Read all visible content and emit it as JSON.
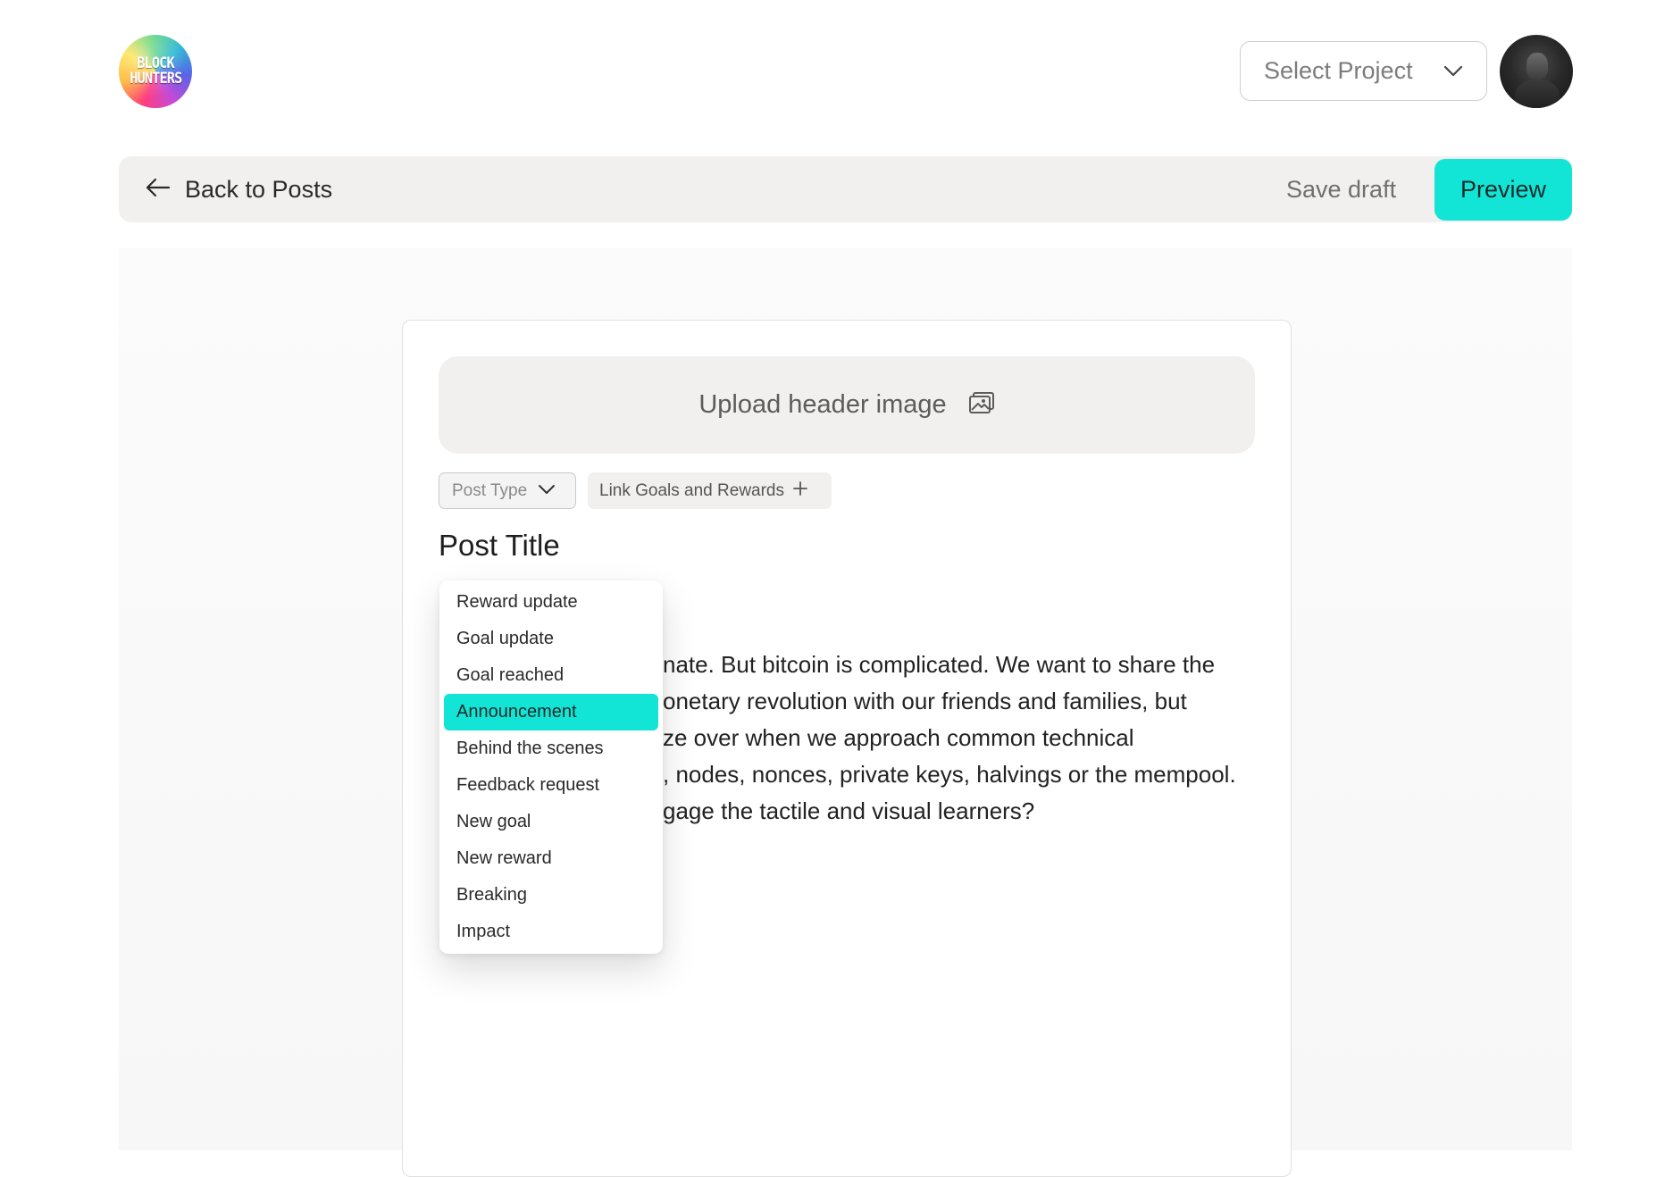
{
  "header": {
    "logo_text": "BLOCK HUNTERS",
    "select_project": {
      "label": "Select Project",
      "chevron_icon": "chevron-down-icon"
    },
    "avatar_icon": "user-avatar"
  },
  "toolbar": {
    "back_label": "Back to Posts",
    "back_icon": "arrow-left-icon",
    "save_draft_label": "Save draft",
    "preview_label": "Preview"
  },
  "editor": {
    "upload_label": "Upload header image",
    "upload_icon": "image-icon",
    "post_type_label": "Post Type",
    "link_goals_label": "Link Goals and Rewards",
    "link_goals_icon": "plus-icon",
    "post_title": "Post Title",
    "body_lines": [
      "nate. But bitcoin is complicated. We want to share the",
      "onetary revolution with our friends and families, but",
      "ze over when we approach common technical",
      ", nodes, nonces, private keys, halvings or the mempool.",
      "gage the tactile and visual learners?"
    ]
  },
  "post_type_menu": {
    "selected_index": 3,
    "items": [
      "Reward update",
      "Goal update",
      "Goal reached",
      "Announcement",
      "Behind the scenes",
      "Feedback request",
      "New goal",
      "New reward",
      "Breaking",
      "Impact"
    ]
  },
  "colors": {
    "accent": "#12e5d6",
    "toolbar_bg": "#f1f0ef",
    "text_primary": "#1f1f1f",
    "text_muted": "#7c7c7c"
  }
}
